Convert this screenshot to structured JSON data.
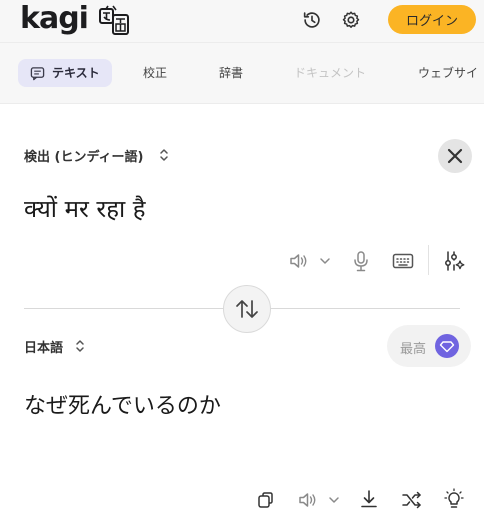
{
  "app": {
    "logo_text": "kagi",
    "login_label": "ログイン"
  },
  "tabs": [
    {
      "label": "テキスト",
      "state": "active"
    },
    {
      "label": "校正",
      "state": "normal"
    },
    {
      "label": "辞書",
      "state": "normal"
    },
    {
      "label": "ドキュメント",
      "state": "disabled"
    },
    {
      "label": "ウェブサイ",
      "state": "normal"
    }
  ],
  "source": {
    "language": "検出 (ヒンディー語)",
    "text": "क्यों मर रहा है"
  },
  "target": {
    "language": "日本語",
    "quality_label": "最高",
    "text": "なぜ死んでいるのか"
  },
  "colors": {
    "accent": "#fbb424",
    "active_tab_bg": "#e6e6f7",
    "quality_badge": "#7064e0"
  },
  "icons": {
    "header": [
      "history-icon",
      "gear-icon"
    ],
    "source_toolbar": [
      "speaker-icon",
      "chevron-down-icon",
      "microphone-icon",
      "keyboard-icon",
      "sliders-sparkle-icon"
    ],
    "target_toolbar": [
      "copy-icon",
      "speaker-icon",
      "chevron-down-icon",
      "download-icon",
      "shuffle-icon",
      "lightbulb-icon"
    ]
  }
}
